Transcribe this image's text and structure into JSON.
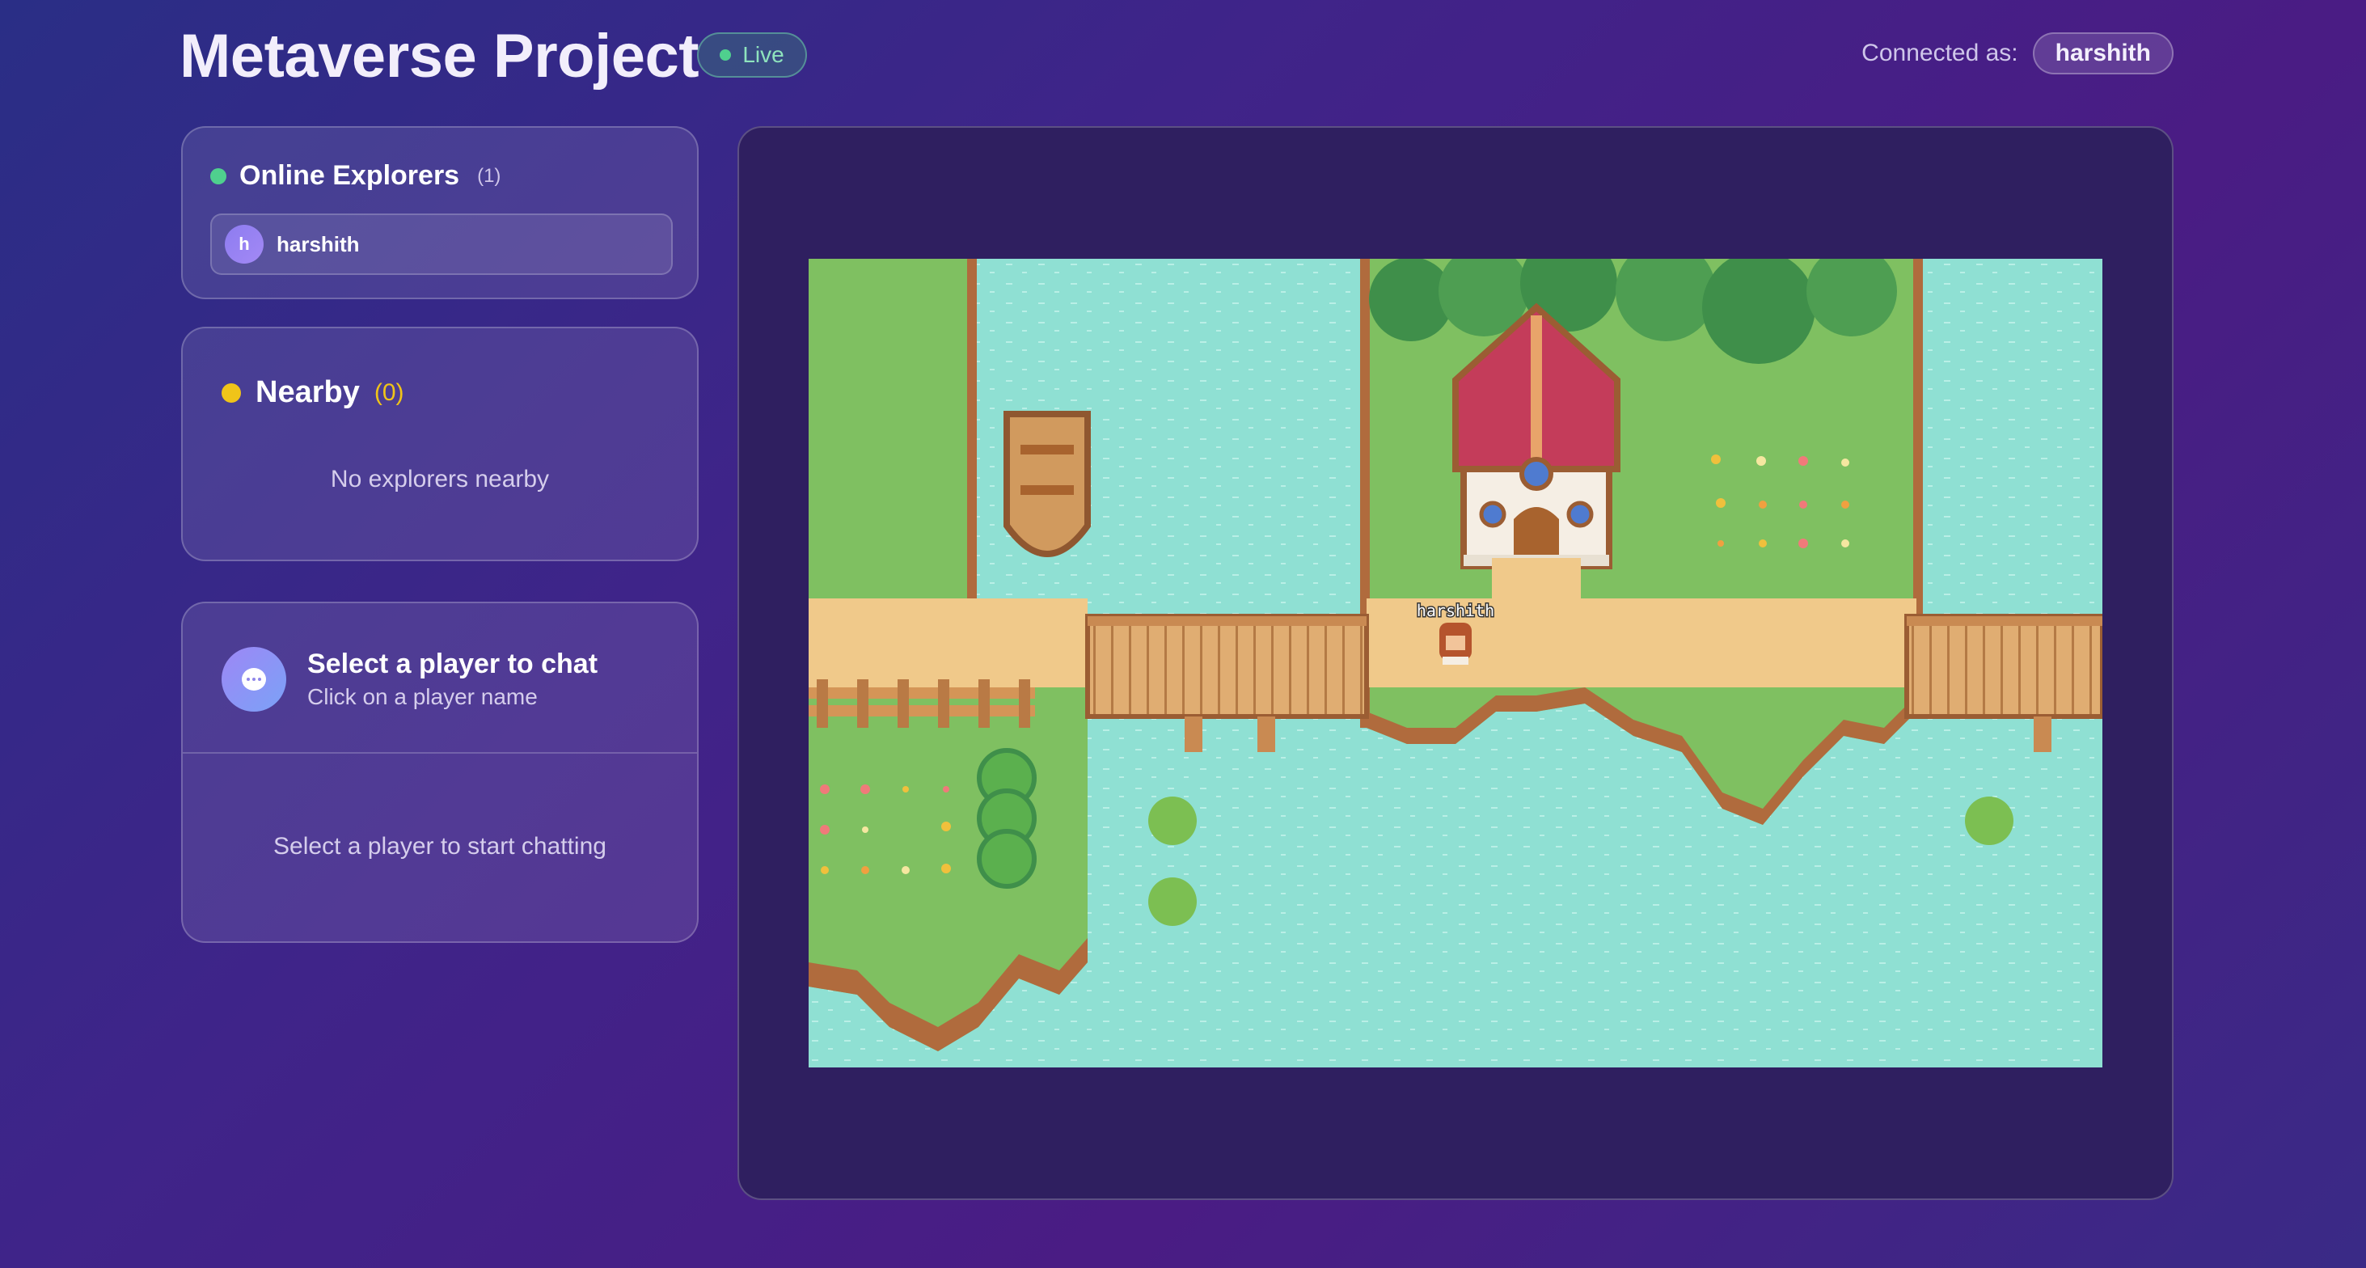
{
  "header": {
    "title": "Metaverse Project",
    "status_label": "Live",
    "connected_label": "Connected as:",
    "username": "harshith"
  },
  "online": {
    "title": "Online Explorers",
    "count": "(1)",
    "players": [
      {
        "initial": "h",
        "name": "harshith"
      }
    ]
  },
  "nearby": {
    "title": "Nearby",
    "count": "(0)",
    "empty_text": "No explorers nearby"
  },
  "chat": {
    "title": "Select a player to chat",
    "subtitle": "Click on a player name",
    "empty_text": "Select a player to start chatting"
  },
  "game": {
    "player_label": "harshith"
  },
  "colors": {
    "live": "#4fd08e",
    "nearby": "#f0c419",
    "water": "#8fe0d3",
    "grass": "#7fc061",
    "path": "#f0c98a"
  }
}
